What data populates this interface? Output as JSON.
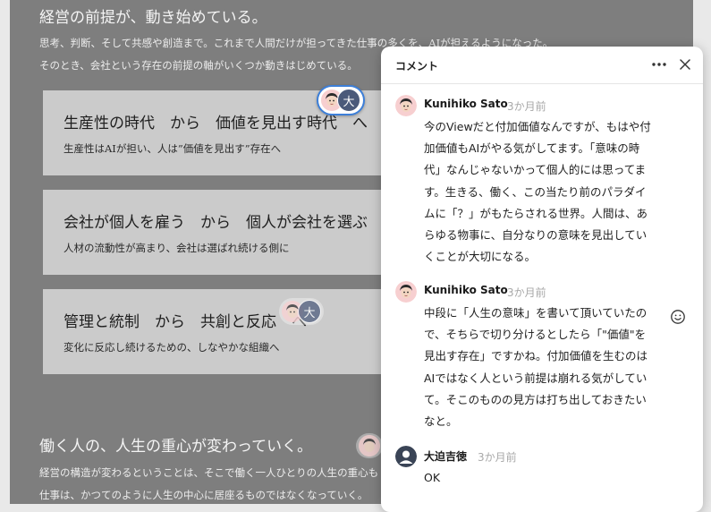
{
  "document": {
    "heading": "経営の前提が、動き始めている。",
    "intro_lines": [
      "思考、判断、そして共感や創造まで。これまで人間だけが担ってきた仕事の多くを、AIが担えるようになった。",
      "そのとき、会社という存在の前提の軸がいくつか動きはじめている。"
    ],
    "cards": [
      {
        "title": "生産性の時代　から　価値を見出す時代　へ",
        "subtitle": "生産性はAIが担い、人は”価値を見出す”存在へ"
      },
      {
        "title": "会社が個人を雇う　から　個人が会社を選ぶ",
        "subtitle": "人材の流動性が高まり、会社は選ばれ続ける側に"
      },
      {
        "title": "管理と統制　から　共創と反応　へ",
        "subtitle": "変化に反応し続けるための、しなやかな組織へ"
      }
    ],
    "section2_heading": "働く人の、人生の重心が変わっていく。",
    "section2_lines": [
      "経営の構造が変わるということは、そこで働く一人ひとりの人生の重心も",
      "仕事は、かつてのように人生の中心に居座るものではなくなっていく。"
    ],
    "marker_letter": "大"
  },
  "panel": {
    "title": "コメント",
    "comments": [
      {
        "author": "Kunihiko Sato",
        "time": "3か月前",
        "avatar": "face-avatar",
        "lines": [
          "今のViewだと付加価値なんですが、もはや付",
          "加価値もAIがやる気がしてます。「意味の時",
          "代」なんじゃないかって個人的には思ってま",
          "す。生きる、働く、この当たり前のパラダイ",
          "ムに「？」がもたらされる世界。人間は、あ",
          "らゆる物事に、自分なりの意味を見出してい",
          "くことが大切になる。"
        ]
      },
      {
        "author": "Kunihiko Sato",
        "time": "3か月前",
        "avatar": "face-avatar",
        "lines": [
          "中段に「人生の意味」を書いて頂いていたの",
          "で、そちらで切り分けるとしたら「\"価値\"を",
          "見出す存在」ですかね。付加価値を生むのは",
          "AIではなく人という前提は崩れる気がしてい",
          "て。そこのものの見方は打ち出しておきたい",
          "なと。"
        ]
      },
      {
        "author": "大迫吉徳",
        "time": "3か月前",
        "avatar": "user-silhouette-icon",
        "lines": [
          "OK"
        ]
      }
    ]
  }
}
